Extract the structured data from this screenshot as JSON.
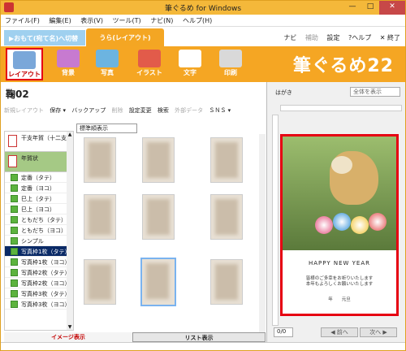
{
  "window": {
    "title": "筆ぐるめ for Windows",
    "min": "—",
    "max": "□",
    "close": "✕"
  },
  "menu": [
    "ファイル(F)",
    "編集(E)",
    "表示(V)",
    "ツール(T)",
    "ナビ(N)",
    "ヘルプ(H)"
  ],
  "tabs": {
    "front_switch": "▶おもて(宛て名)へ切替",
    "back": "うら(レイアウト)"
  },
  "toplinks": {
    "navi": "ナビ",
    "assist": "補助",
    "settings": "設定",
    "help": "?ヘルプ",
    "exit": "✕ 終了"
  },
  "ribbon": {
    "items": [
      "レイアウト",
      "背景",
      "写真",
      "イラスト",
      "文字",
      "印刷"
    ],
    "selected": "レイアウト",
    "brand": "筆ぐるめ22"
  },
  "left": {
    "title": "鞠02",
    "toolbar": [
      "新規レイアウト",
      "保存 ▾",
      "バックアップ",
      "削除",
      "設定変更",
      "検索",
      "外部データ",
      "ＳＮＳ ▾"
    ],
    "sort": "標準順表示",
    "categories_big": [
      "干支年賀（十二支）",
      "年賀状"
    ],
    "categories": [
      "定番（タテ）",
      "定番（ヨコ）",
      "巳上（タテ）",
      "巳上（ヨコ）",
      "ともだち（タテ）",
      "ともだち（ヨコ）",
      "シンプル",
      "写真枠1枚（タテ）",
      "写真枠1枚（ヨコ）",
      "写真枠2枚（タテ）",
      "写真枠2枚（ヨコ）",
      "写真枠3枚（タテ）",
      "写真枠3枚（ヨコ）"
    ],
    "selected_category": "写真枠1枚（タテ）",
    "view_tabs": {
      "image": "イメージ表示",
      "list": "リスト表示"
    },
    "scroll_up": "▲",
    "scroll_down": "▼"
  },
  "right": {
    "label": "はがき",
    "zoom": "全体を表示",
    "card": {
      "greeting_en": "HAPPY NEW YEAR",
      "greeting_jp1": "皆様のご多幸をお祈りいたします",
      "greeting_jp2": "本年もよろしくお願いいたします",
      "sign": "年　　元旦"
    },
    "page": "0/0",
    "prev": "◀ 前へ",
    "next": "次へ ▶"
  },
  "colors": {
    "accent": "#f5a623",
    "title": "#f4b83a",
    "selection": "#e60012",
    "list_selected": "#0a2a66"
  }
}
